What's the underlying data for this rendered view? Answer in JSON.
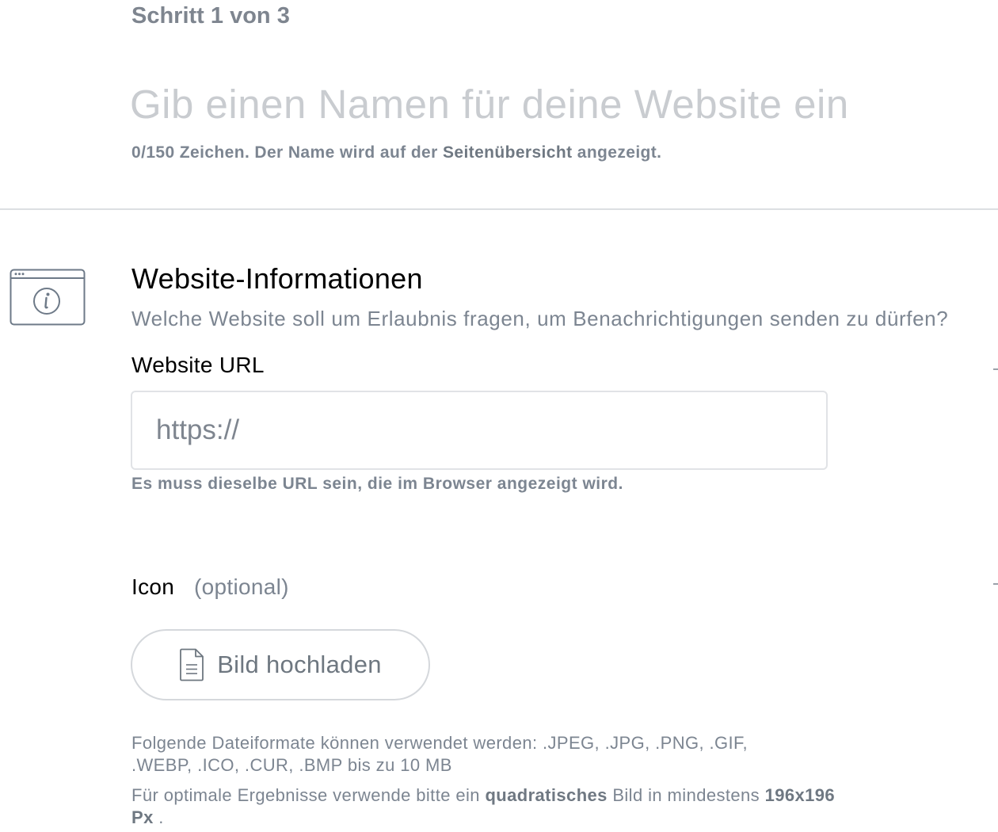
{
  "step": {
    "text": "Schritt 1 von 3"
  },
  "name": {
    "placeholder": "Gib einen Namen für deine Website ein",
    "value": "",
    "hint_prefix": "0/150 Zeichen. Der Name wird auf der ",
    "hint_bold": "Seitenübersicht",
    "hint_suffix": " angezeigt."
  },
  "section": {
    "icon": "browser-info-icon",
    "title": "Website-Informationen",
    "subtitle": "Welche Website soll um Erlaubnis fragen, um Benachrichtigungen senden zu dürfen?"
  },
  "url": {
    "label": "Website URL",
    "placeholder": "https://",
    "value": "",
    "hint": "Es muss dieselbe URL sein, die im Browser angezeigt wird."
  },
  "icon_upload": {
    "label": "Icon",
    "optional": "(optional)",
    "button_icon": "document-icon",
    "button_label": "Bild hochladen",
    "formats": "Folgende Dateiformate können verwendet werden: .JPEG, .JPG, .PNG, .GIF, .WEBP, .ICO, .CUR, .BMP bis zu 10 MB",
    "optimal_prefix": "Für optimale Ergebnisse verwende bitte ein ",
    "optimal_bold1": "quadratisches",
    "optimal_middle": " Bild in mindestens ",
    "optimal_bold2": "196x196 Px",
    "optimal_suffix": " ."
  },
  "colors": {
    "text_muted": "#7c8591",
    "placeholder_light": "#c9ccd0",
    "border": "#e1e3e6",
    "icon_stroke": "#6e7a88"
  }
}
